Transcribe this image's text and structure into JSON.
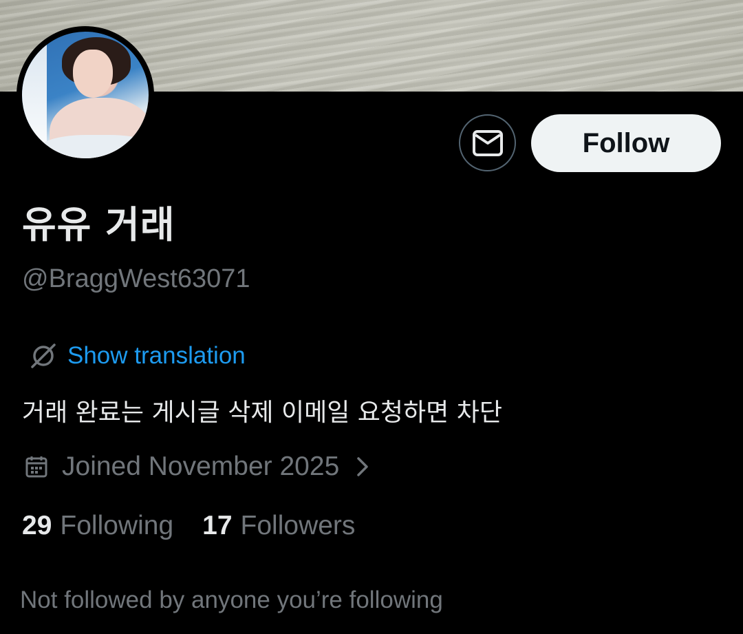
{
  "profile": {
    "display_name": "유유 거래",
    "handle": "@BraggWest63071",
    "bio": "거래 완료는 게시글 삭제 이메일 요청하면 차단",
    "translate_label": "Show translation",
    "joined": "Joined November 2025",
    "following_count": "29",
    "following_label": "Following",
    "followers_count": "17",
    "followers_label": "Followers",
    "mutuals_note": "Not followed by anyone you’re following"
  },
  "actions": {
    "follow_label": "Follow",
    "message_icon": "envelope-icon"
  },
  "colors": {
    "background": "#000000",
    "primary_text": "#e7e9ea",
    "secondary_text": "#71767b",
    "link": "#1d9bf0",
    "follow_bg": "#eff3f4"
  }
}
